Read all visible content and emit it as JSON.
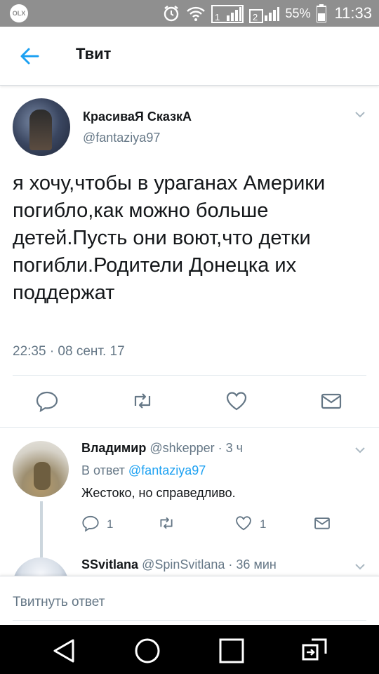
{
  "status_bar": {
    "app_badge": "OLX",
    "sim1_label": "1",
    "sim2_label": "2",
    "battery": "55%",
    "time": "11:33"
  },
  "header": {
    "title": "Твит",
    "back_icon": "arrow-left-icon"
  },
  "tweet": {
    "author_name": "КрасиваЯ СказкА",
    "author_handle": "@fantaziya97",
    "text": "я хочу,чтобы в ураганах Америки погибло,как можно больше детей.Пусть они воют,что детки погибли.Родители Донецка их поддержат",
    "timestamp": "22:35 · 08 сент. 17",
    "actions": [
      "reply-icon",
      "retweet-icon",
      "like-icon",
      "direct-message-icon"
    ]
  },
  "replies": [
    {
      "name": "Владимир",
      "handle": "@shkepper",
      "time": "· 3 ч",
      "reply_to_prefix": "В ответ",
      "reply_to_handle": "@fantaziya97",
      "text": "Жестоко, но справедливо.",
      "reply_count": "1",
      "like_count": "1"
    },
    {
      "name": "SSvitlana",
      "handle": "@SpinSvitlana",
      "time": "· 36 мин"
    }
  ],
  "composer": {
    "placeholder": "Твитнуть ответ"
  },
  "colors": {
    "accent": "#1da1f2",
    "secondary_text": "#657786",
    "status_bar": "#8f8f8f",
    "nav_bar": "#000000"
  }
}
